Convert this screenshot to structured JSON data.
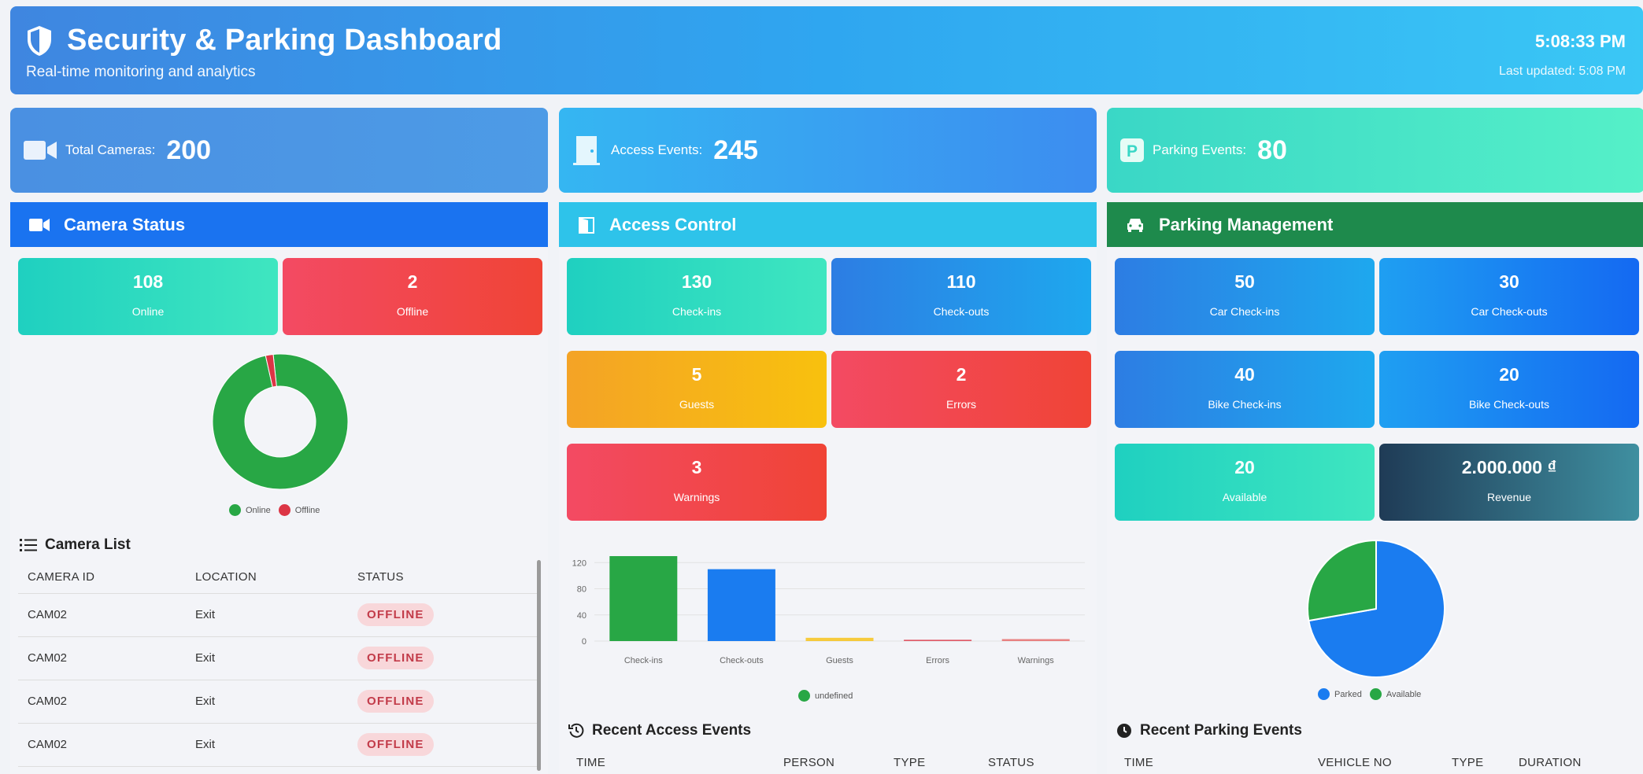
{
  "header": {
    "title": "Security & Parking Dashboard",
    "subtitle": "Real-time monitoring and analytics",
    "clock": "5:08:33 PM",
    "updated": "Last updated: 5:08 PM"
  },
  "kpis": [
    {
      "label": "Total Cameras:",
      "value": "200",
      "icon": "video-camera-icon"
    },
    {
      "label": "Access Events:",
      "value": "245",
      "icon": "door-icon"
    },
    {
      "label": "Parking Events:",
      "value": "80",
      "icon": "parking-icon"
    }
  ],
  "camera_panel": {
    "title": "Camera Status",
    "tiles": [
      {
        "value": "108",
        "label": "Online"
      },
      {
        "value": "2",
        "label": "Offline"
      }
    ],
    "legend": [
      "Online",
      "Offline"
    ],
    "list_title": "Camera List",
    "columns": [
      "CAMERA ID",
      "LOCATION",
      "STATUS"
    ],
    "rows": [
      {
        "id": "CAM02",
        "location": "Exit",
        "status": "OFFLINE"
      },
      {
        "id": "CAM02",
        "location": "Exit",
        "status": "OFFLINE"
      },
      {
        "id": "CAM02",
        "location": "Exit",
        "status": "OFFLINE"
      },
      {
        "id": "CAM02",
        "location": "Exit",
        "status": "OFFLINE"
      }
    ]
  },
  "access_panel": {
    "title": "Access Control",
    "tiles": [
      {
        "value": "130",
        "label": "Check-ins"
      },
      {
        "value": "110",
        "label": "Check-outs"
      },
      {
        "value": "5",
        "label": "Guests"
      },
      {
        "value": "2",
        "label": "Errors"
      },
      {
        "value": "3",
        "label": "Warnings"
      }
    ],
    "recent_title": "Recent Access Events",
    "columns": [
      "TIME",
      "PERSON",
      "TYPE",
      "STATUS"
    ]
  },
  "parking_panel": {
    "title": "Parking Management",
    "tiles": [
      {
        "value": "50",
        "label": "Car Check-ins"
      },
      {
        "value": "30",
        "label": "Car Check-outs"
      },
      {
        "value": "40",
        "label": "Bike Check-ins"
      },
      {
        "value": "20",
        "label": "Bike Check-outs"
      },
      {
        "value": "20",
        "label": "Available"
      },
      {
        "value": "2.000.000 ₫",
        "label": "Revenue"
      }
    ],
    "legend": [
      "Parked",
      "Available"
    ],
    "recent_title": "Recent Parking Events",
    "columns": [
      "TIME",
      "VEHICLE NO",
      "TYPE",
      "DURATION"
    ]
  },
  "colors": {
    "online": "#28a745",
    "offline": "#dc3545",
    "parked": "#1a7cf0",
    "available": "#28a745"
  },
  "chart_data": [
    {
      "type": "pie",
      "donut": true,
      "categories": [
        "Online",
        "Offline"
      ],
      "values": [
        108,
        2
      ],
      "legend": "bottom"
    },
    {
      "type": "bar",
      "categories": [
        "Check-ins",
        "Check-outs",
        "Guests",
        "Errors",
        "Warnings"
      ],
      "values": [
        130,
        110,
        5,
        2,
        3
      ],
      "yticks": [
        0,
        40,
        80,
        120
      ],
      "ylim": [
        0,
        130
      ],
      "colors": [
        "#28a745",
        "#1a7cf0",
        "#f8c10e",
        "#dc3545",
        "#e66565"
      ],
      "legend_label": "undefined",
      "grid": true
    },
    {
      "type": "pie",
      "categories": [
        "Parked",
        "Available"
      ],
      "values": [
        52,
        20
      ],
      "legend": "bottom"
    }
  ]
}
